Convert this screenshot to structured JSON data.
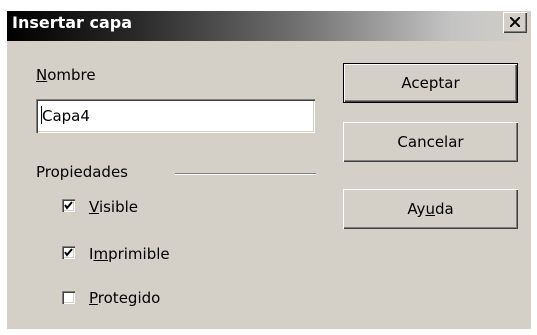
{
  "window": {
    "title": "Insertar capa"
  },
  "form": {
    "name_label_accesskey": "N",
    "name_label_rest": "ombre",
    "name_value": "Capa4",
    "properties_label": "Propiedades",
    "checkboxes": [
      {
        "pre": "",
        "key": "V",
        "post": "isible",
        "checked": true
      },
      {
        "pre": "I",
        "key": "m",
        "post": "primible",
        "checked": true
      },
      {
        "pre": "",
        "key": "P",
        "post": "rotegido",
        "checked": false
      }
    ]
  },
  "buttons": {
    "ok": "Aceptar",
    "cancel": "Cancelar",
    "help_pre": "Ay",
    "help_key": "u",
    "help_post": "da"
  },
  "icons": {
    "close": "close-icon",
    "check": "checkmark-icon"
  }
}
